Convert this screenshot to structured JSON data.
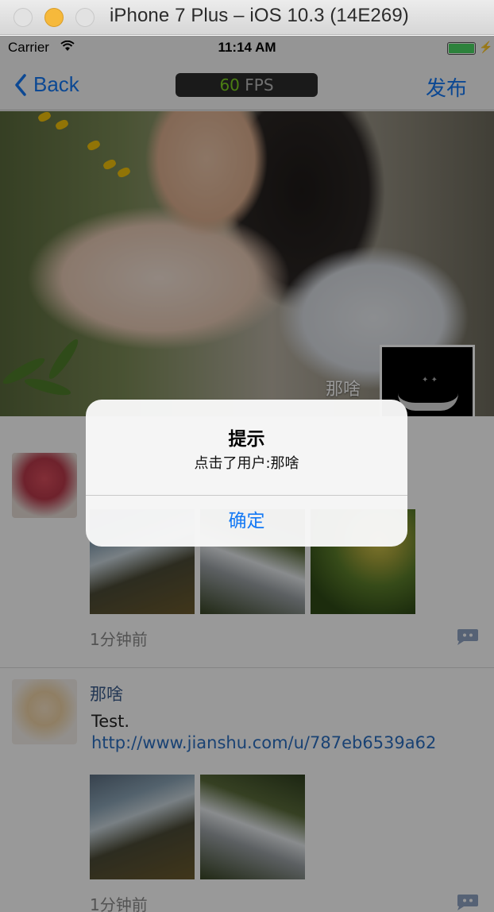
{
  "window": {
    "title": "iPhone 7 Plus – iOS 10.3 (14E269)"
  },
  "status_bar": {
    "carrier": "Carrier",
    "time": "11:14 AM"
  },
  "nav": {
    "back_label": "Back",
    "fps_value": "60",
    "fps_unit": "FPS",
    "right_action": "发布"
  },
  "header": {
    "username": "那啥"
  },
  "feed": {
    "items": [
      {
        "time": "1分钟前"
      },
      {
        "username": "那啥",
        "text": "Test.",
        "link": "http://www.jianshu.com/u/787eb6539a62",
        "time": "1分钟前"
      }
    ]
  },
  "alert": {
    "title": "提示",
    "message": "点击了用户:那啥",
    "confirm": "确定"
  }
}
